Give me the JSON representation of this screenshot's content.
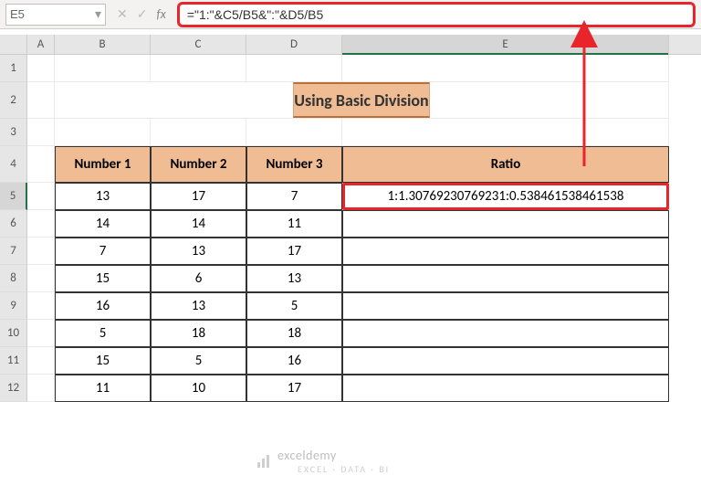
{
  "name_box": "E5",
  "formula": "=\"1:\"&C5/B5&\":\"&D5/B5",
  "columns": [
    "A",
    "B",
    "C",
    "D",
    "E"
  ],
  "rows": [
    "1",
    "2",
    "3",
    "4",
    "5",
    "6",
    "7",
    "8",
    "9",
    "10",
    "11",
    "12"
  ],
  "title": "Using Basic Division",
  "headers": {
    "b": "Number 1",
    "c": "Number 2",
    "d": "Number 3",
    "e": "Ratio"
  },
  "data": [
    {
      "b": "13",
      "c": "17",
      "d": "7",
      "e": "1:1.30769230769231:0.538461538461538"
    },
    {
      "b": "14",
      "c": "14",
      "d": "11",
      "e": ""
    },
    {
      "b": "7",
      "c": "13",
      "d": "17",
      "e": ""
    },
    {
      "b": "15",
      "c": "6",
      "d": "13",
      "e": ""
    },
    {
      "b": "16",
      "c": "13",
      "d": "5",
      "e": ""
    },
    {
      "b": "5",
      "c": "18",
      "d": "18",
      "e": ""
    },
    {
      "b": "15",
      "c": "5",
      "d": "16",
      "e": ""
    },
    {
      "b": "11",
      "c": "10",
      "d": "17",
      "e": ""
    }
  ],
  "watermark": {
    "brand": "exceldemy",
    "tag": "EXCEL · DATA · BI"
  },
  "chart_data": {
    "type": "table",
    "title": "Using Basic Division",
    "columns": [
      "Number 1",
      "Number 2",
      "Number 3",
      "Ratio"
    ],
    "rows": [
      [
        13,
        17,
        7,
        "1:1.30769230769231:0.538461538461538"
      ],
      [
        14,
        14,
        11,
        null
      ],
      [
        7,
        13,
        17,
        null
      ],
      [
        15,
        6,
        13,
        null
      ],
      [
        16,
        13,
        5,
        null
      ],
      [
        5,
        18,
        18,
        null
      ],
      [
        15,
        5,
        16,
        null
      ],
      [
        11,
        10,
        17,
        null
      ]
    ]
  }
}
